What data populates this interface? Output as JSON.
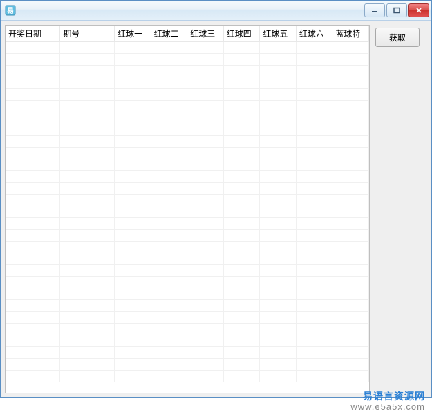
{
  "window": {
    "title": ""
  },
  "table": {
    "columns": [
      "开奖日期",
      "期号",
      "红球一",
      "红球二",
      "红球三",
      "红球四",
      "红球五",
      "红球六",
      "蓝球特"
    ],
    "rows": []
  },
  "side": {
    "fetch_label": "获取"
  },
  "watermark": {
    "line1": "易语言资源网",
    "line2": "www.e5a5x.com"
  }
}
